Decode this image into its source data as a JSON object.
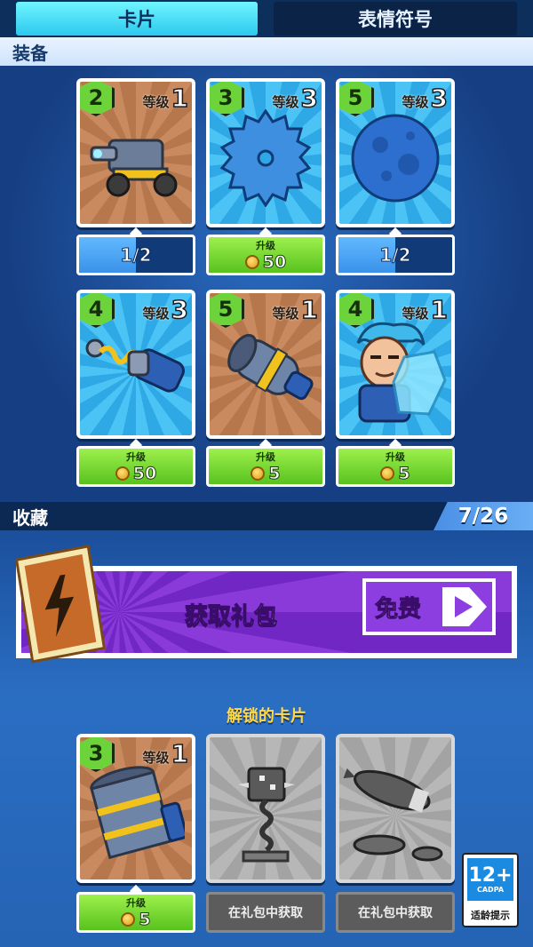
{
  "tabs": [
    {
      "label": "卡片",
      "active": true
    },
    {
      "label": "表情符号",
      "active": false
    }
  ],
  "sections": {
    "equip": "装备",
    "collect": "收藏",
    "collect_count": "7/26"
  },
  "level_label": "等级",
  "upgrade_label": "升级",
  "equipped_cards": [
    {
      "badge": "2",
      "level": "1",
      "art": "cannon-cart-icon",
      "footer": {
        "type": "progress",
        "text": "1/2",
        "progress": 0.5
      }
    },
    {
      "badge": "3",
      "level": "3",
      "art": "saw-blade-icon",
      "footer": {
        "type": "upgrade",
        "cost": "50"
      }
    },
    {
      "badge": "5",
      "level": "3",
      "art": "meteor-icon",
      "footer": {
        "type": "progress",
        "text": "1/2",
        "progress": 0.5
      }
    },
    {
      "badge": "4",
      "level": "3",
      "art": "spring-gun-icon",
      "footer": {
        "type": "upgrade",
        "cost": "50"
      }
    },
    {
      "badge": "5",
      "level": "1",
      "art": "big-cannon-icon",
      "footer": {
        "type": "upgrade",
        "cost": "5"
      }
    },
    {
      "badge": "4",
      "level": "1",
      "art": "hero-shield-icon",
      "footer": {
        "type": "upgrade",
        "cost": "5"
      }
    }
  ],
  "pack_banner": {
    "title": "获取礼包",
    "button": "免费"
  },
  "unlocked_title": "解锁的卡片",
  "unlocked_cards": [
    {
      "badge": "3",
      "level": "1",
      "art": "barrel-cannon-icon",
      "footer": {
        "type": "upgrade",
        "cost": "5"
      }
    },
    {
      "art": "spiked-mace-icon",
      "footer": {
        "type": "locked",
        "text": "在礼包中获取"
      }
    },
    {
      "art": "missiles-icon",
      "footer": {
        "type": "locked",
        "text": "在礼包中获取"
      }
    }
  ],
  "age_rating": {
    "age": "12+",
    "org": "CADPA",
    "caption": "适龄提示"
  },
  "colors": {
    "tab_active": "#2cc9ee",
    "upgrade_green": "#58c21f",
    "progress_blue": "#3a92ea",
    "banner_purple": "#8a3ad8"
  }
}
